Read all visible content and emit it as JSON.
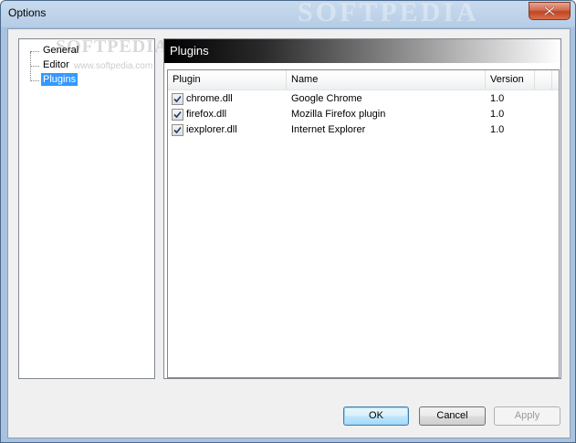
{
  "window": {
    "title": "Options",
    "watermark": "SOFTPEDIA"
  },
  "tree": {
    "items": [
      {
        "label": "General",
        "selected": false
      },
      {
        "label": "Editor",
        "selected": false
      },
      {
        "label": "Plugins",
        "selected": true
      }
    ],
    "watermark": "SOFTPEDIA",
    "watermark_sub": "www.softpedia.com"
  },
  "panel": {
    "title": "Plugins",
    "columns": [
      "Plugin",
      "Name",
      "Version"
    ],
    "rows": [
      {
        "checked": true,
        "plugin": "chrome.dll",
        "name": "Google Chrome",
        "version": "1.0"
      },
      {
        "checked": true,
        "plugin": "firefox.dll",
        "name": "Mozilla Firefox plugin",
        "version": "1.0"
      },
      {
        "checked": true,
        "plugin": "iexplorer.dll",
        "name": "Internet Explorer",
        "version": "1.0"
      }
    ]
  },
  "buttons": {
    "ok": "OK",
    "cancel": "Cancel",
    "apply": "Apply"
  },
  "colors": {
    "selection": "#3399ff",
    "close_button": "#c1441f"
  }
}
